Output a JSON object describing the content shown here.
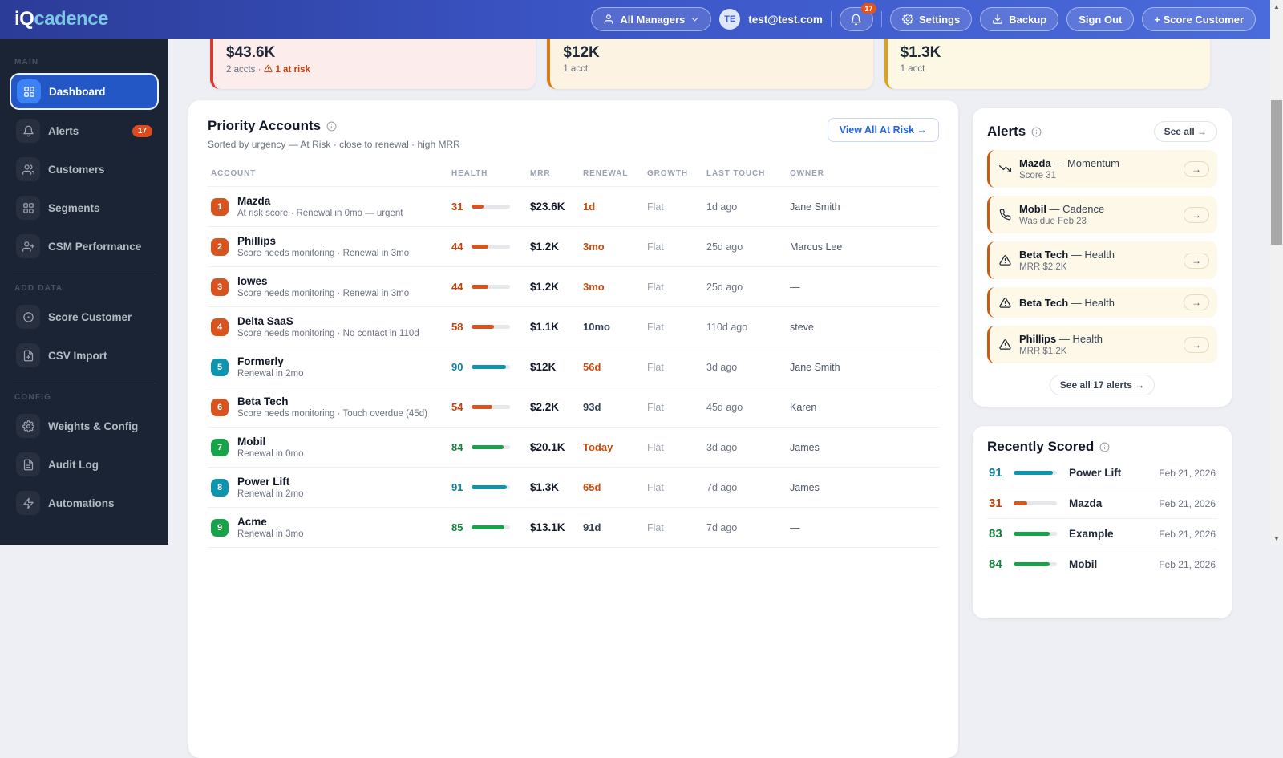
{
  "colors": {
    "accent_blue": "#2563eb",
    "orange": "#d9531e",
    "teal": "#0d94ae",
    "green": "#16a34a",
    "alert_bg": "#fdf8e7",
    "sidebar_bg": "#1b2434",
    "header_gradient_start": "#2b3b97",
    "header_gradient_end": "#4a6bdb"
  },
  "header": {
    "logo_iq": "iQ",
    "logo_cadence": "cadence",
    "manager_dropdown": "All Managers",
    "avatar_initials": "TE",
    "user_email": "test@test.com",
    "notification_count": "17",
    "settings_label": "Settings",
    "backup_label": "Backup",
    "sign_out_label": "Sign Out",
    "score_customer_label": "+ Score Customer"
  },
  "sidebar": {
    "sections": [
      {
        "label": "MAIN",
        "items": [
          {
            "label": "Dashboard",
            "icon": "grid",
            "active": true
          },
          {
            "label": "Alerts",
            "icon": "bell",
            "badge": "17"
          },
          {
            "label": "Customers",
            "icon": "users"
          },
          {
            "label": "Segments",
            "icon": "grid"
          },
          {
            "label": "CSM Performance",
            "icon": "user-plus"
          }
        ]
      },
      {
        "label": "ADD DATA",
        "items": [
          {
            "label": "Score Customer",
            "icon": "target"
          },
          {
            "label": "CSV Import",
            "icon": "file"
          }
        ]
      },
      {
        "label": "CONFIG",
        "items": [
          {
            "label": "Weights & Config",
            "icon": "gear"
          },
          {
            "label": "Audit Log",
            "icon": "doc"
          },
          {
            "label": "Automations",
            "icon": "lightning"
          }
        ]
      }
    ]
  },
  "stat_cards": [
    {
      "value": "$43.6K",
      "sub": "2 accts ·",
      "risk": "1 at risk",
      "variant": "red"
    },
    {
      "value": "$12K",
      "sub": "1 acct",
      "variant": "orange"
    },
    {
      "value": "$1.3K",
      "sub": "1 acct",
      "variant": "yellow"
    }
  ],
  "priority": {
    "title": "Priority Accounts",
    "subtitle": "Sorted by urgency — At Risk · close to renewal · high MRR",
    "view_all_label": "View All At Risk →",
    "columns": [
      "ACCOUNT",
      "HEALTH",
      "MRR",
      "RENEWAL",
      "GROWTH",
      "LAST TOUCH",
      "OWNER"
    ],
    "rows": [
      {
        "rank": "1",
        "color": "orange",
        "name": "Mazda",
        "desc": "At risk score · Renewal in 0mo — urgent",
        "health": 31,
        "health_color": "orange",
        "mrr": "$23.6K",
        "renewal": "1d",
        "renewal_urgent": true,
        "growth": "Flat",
        "last_touch": "1d ago",
        "owner": "Jane Smith"
      },
      {
        "rank": "2",
        "color": "orange",
        "name": "Phillips",
        "desc": "Score needs monitoring · Renewal in 3mo",
        "health": 44,
        "health_color": "orange",
        "mrr": "$1.2K",
        "renewal": "3mo",
        "renewal_urgent": true,
        "growth": "Flat",
        "last_touch": "25d ago",
        "owner": "Marcus Lee"
      },
      {
        "rank": "3",
        "color": "orange",
        "name": "lowes",
        "desc": "Score needs monitoring · Renewal in 3mo",
        "health": 44,
        "health_color": "orange",
        "mrr": "$1.2K",
        "renewal": "3mo",
        "renewal_urgent": true,
        "growth": "Flat",
        "last_touch": "25d ago",
        "owner": "—"
      },
      {
        "rank": "4",
        "color": "orange",
        "name": "Delta SaaS",
        "desc": "Score needs monitoring · No contact in 110d",
        "health": 58,
        "health_color": "orange",
        "mrr": "$1.1K",
        "renewal": "10mo",
        "renewal_urgent": false,
        "growth": "Flat",
        "last_touch": "110d ago",
        "owner": "steve"
      },
      {
        "rank": "5",
        "color": "teal",
        "name": "Formerly",
        "desc": "Renewal in 2mo",
        "health": 90,
        "health_color": "teal",
        "mrr": "$12K",
        "renewal": "56d",
        "renewal_urgent": true,
        "growth": "Flat",
        "last_touch": "3d ago",
        "owner": "Jane Smith"
      },
      {
        "rank": "6",
        "color": "orange",
        "name": "Beta Tech",
        "desc": "Score needs monitoring · Touch overdue (45d)",
        "health": 54,
        "health_color": "orange",
        "mrr": "$2.2K",
        "renewal": "93d",
        "renewal_urgent": false,
        "growth": "Flat",
        "last_touch": "45d ago",
        "owner": "Karen"
      },
      {
        "rank": "7",
        "color": "green",
        "name": "Mobil",
        "desc": "Renewal in 0mo",
        "health": 84,
        "health_color": "green",
        "mrr": "$20.1K",
        "renewal": "Today",
        "renewal_urgent": true,
        "growth": "Flat",
        "last_touch": "3d ago",
        "owner": "James"
      },
      {
        "rank": "8",
        "color": "teal",
        "name": "Power Lift",
        "desc": "Renewal in 2mo",
        "health": 91,
        "health_color": "teal",
        "mrr": "$1.3K",
        "renewal": "65d",
        "renewal_urgent": true,
        "growth": "Flat",
        "last_touch": "7d ago",
        "owner": "James"
      },
      {
        "rank": "9",
        "color": "green",
        "name": "Acme",
        "desc": "Renewal in 3mo",
        "health": 85,
        "health_color": "green",
        "mrr": "$13.1K",
        "renewal": "91d",
        "renewal_urgent": false,
        "growth": "Flat",
        "last_touch": "7d ago",
        "owner": "—"
      }
    ]
  },
  "alerts": {
    "title": "Alerts",
    "see_all_label": "See all →",
    "footer_label": "See all 17 alerts →",
    "arrow_label": "→",
    "items": [
      {
        "name": "Mazda",
        "suffix": "— Momentum",
        "sub": "Score 31",
        "icon": "trending-down"
      },
      {
        "name": "Mobil",
        "suffix": "— Cadence",
        "sub": "Was due Feb 23",
        "icon": "phone"
      },
      {
        "name": "Beta Tech",
        "suffix": "— Health",
        "sub": "MRR $2.2K",
        "icon": "warning"
      },
      {
        "name": "Beta Tech",
        "suffix": "— Health",
        "sub": "",
        "icon": "warning"
      },
      {
        "name": "Phillips",
        "suffix": "— Health",
        "sub": "MRR $1.2K",
        "icon": "warning"
      }
    ]
  },
  "recently_scored": {
    "title": "Recently Scored",
    "rows": [
      {
        "score": 91,
        "color": "teal",
        "name": "Power Lift",
        "date": "Feb 21, 2026"
      },
      {
        "score": 31,
        "color": "orange",
        "name": "Mazda",
        "date": "Feb 21, 2026"
      },
      {
        "score": 83,
        "color": "green",
        "name": "Example",
        "date": "Feb 21, 2026"
      },
      {
        "score": 84,
        "color": "green",
        "name": "Mobil",
        "date": "Feb 21, 2026"
      }
    ]
  }
}
